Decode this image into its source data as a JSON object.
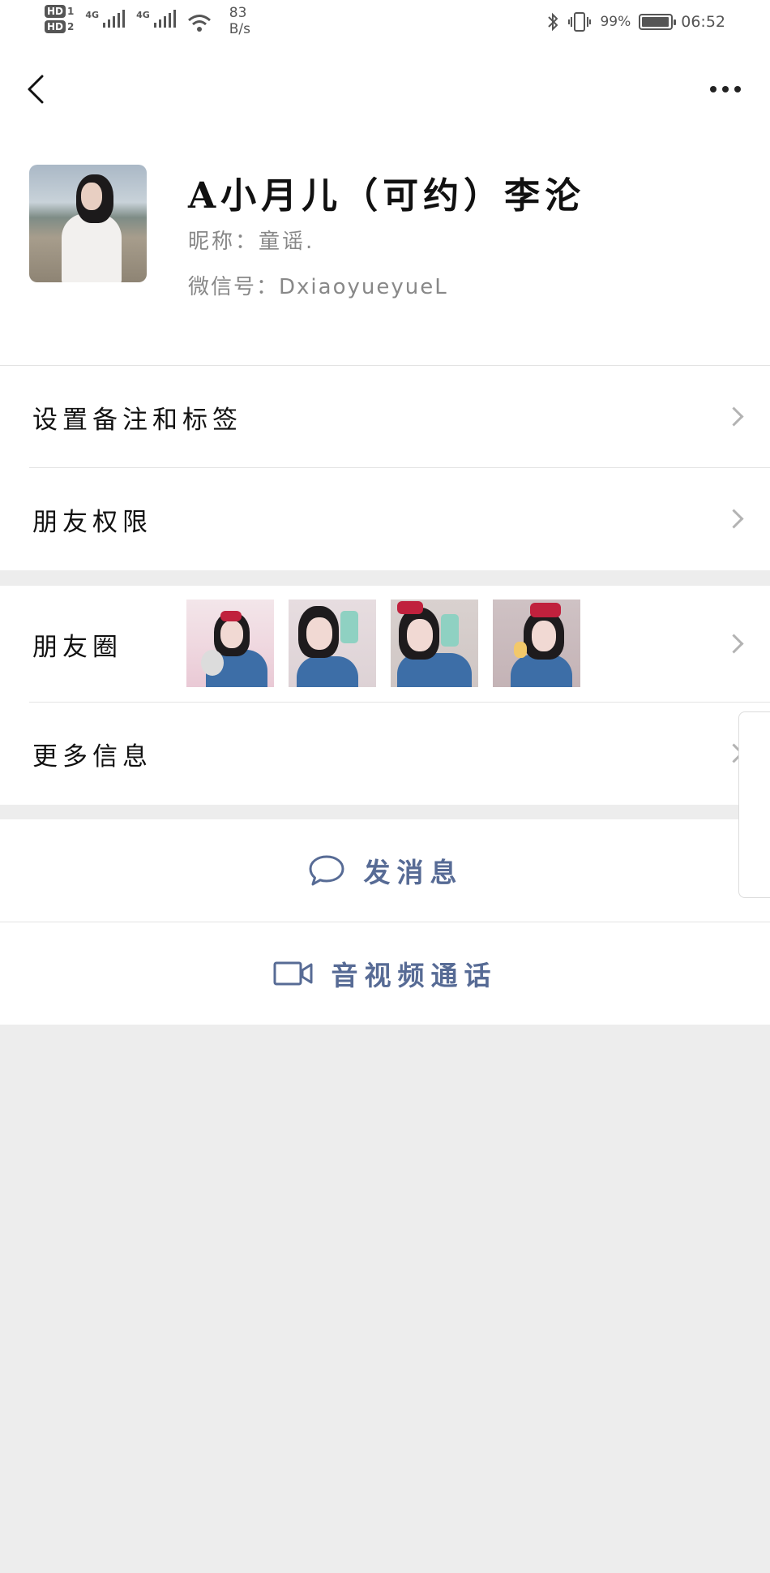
{
  "status_bar": {
    "sim1": "HD",
    "sim1_index": "1",
    "sim2": "HD",
    "sim2_index": "2",
    "net1": "4G",
    "net2": "4G",
    "speed_value": "83",
    "speed_unit": "B/s",
    "battery": "99%",
    "time": "06:52"
  },
  "header": {
    "back_icon": "back-arrow-icon",
    "more_icon": "more-dots-icon"
  },
  "profile": {
    "display_name": "A小月儿（可约）李沦",
    "nickname": "昵称：童谣.",
    "wechat_id": "微信号：DxiaoyueyueL"
  },
  "menu": {
    "remark_tags": "设置备注和标签",
    "friend_permissions": "朋友权限",
    "moments": "朋友圈",
    "more_info": "更多信息"
  },
  "actions": {
    "send_message": "发消息",
    "video_call": "音视频通话"
  },
  "colors": {
    "link_blue": "#576b95",
    "background": "#ededed",
    "chevron": "#b3b3b3"
  }
}
